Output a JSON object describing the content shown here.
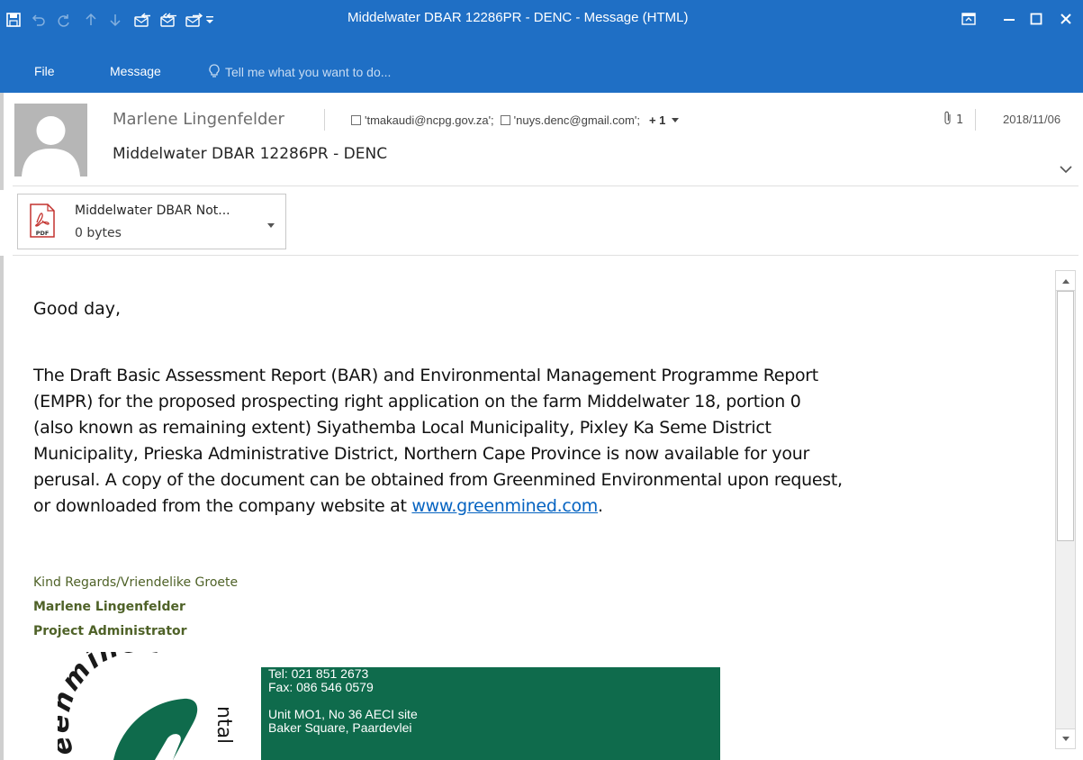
{
  "window": {
    "title": "Middelwater DBAR 12286PR - DENC - Message (HTML)",
    "accent_color": "#1f6fc5"
  },
  "quick_access": {
    "icons": [
      "save-icon",
      "undo-icon",
      "redo-icon",
      "previous-item-icon",
      "next-item-icon",
      "reply-icon",
      "reply-all-icon",
      "forward-icon",
      "customize-quick-access-icon"
    ]
  },
  "ribbon": {
    "tabs": [
      {
        "label": "File"
      },
      {
        "label": "Message"
      }
    ],
    "tell_me": "Tell me what you want to do..."
  },
  "header": {
    "sender": "Marlene Lingenfelder",
    "recipients": [
      "'tmakaudi@ncpg.gov.za';",
      "'nuys.denc@gmail.com';"
    ],
    "more_recipients": "+ 1",
    "attachment_count": "1",
    "date": "2018/11/06",
    "subject": "Middelwater DBAR 12286PR - DENC"
  },
  "attachment": {
    "name": "Middelwater DBAR Not...",
    "size": "0 bytes",
    "type_label": "PDF"
  },
  "body": {
    "greeting": "Good day,",
    "paragraph_lines": [
      "The Draft Basic Assessment Report (BAR) and Environmental Management Programme Report",
      "(EMPR) for the proposed prospecting right application on the farm Middelwater 18, portion 0",
      "(also known as remaining extent) Siyathemba Local Municipality, Pixley Ka Seme District",
      "Municipality, Prieska Administrative District, Northern Cape Province is now available for your",
      "perusal. A copy of the document can be obtained from Greenmined Environmental upon request,"
    ],
    "last_line_prefix": "or downloaded from the company website at ",
    "link_text": "www.greenmined.com",
    "last_line_suffix": ".",
    "signature": {
      "regards": "Kind Regards/Vriendelike Groete",
      "name": "Marlene Lingenfelder",
      "title": "Project Administrator",
      "text_color": "#4f6228"
    },
    "logo": {
      "text_top": "eenmined",
      "text_side": "ntal",
      "color": "#0f6b4c"
    },
    "contact": {
      "tel": "Tel: 021 851 2673",
      "fax": "Fax: 086 546 0579",
      "address1": "Unit MO1, No 36 AECI site",
      "address2": "Baker Square, Paardevlei",
      "background": "#0f6b4c"
    }
  }
}
